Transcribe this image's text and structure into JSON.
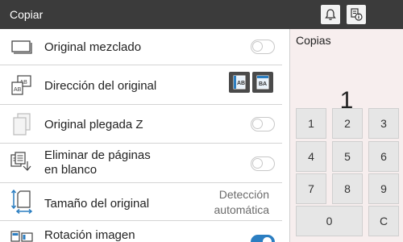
{
  "header": {
    "title": "Copiar"
  },
  "settings": [
    {
      "label": "Original mezclado",
      "control": "toggle",
      "on": false,
      "icon": "stacked-pages-icon"
    },
    {
      "label": "Dirección del original",
      "control": "direction-buttons",
      "icon": "page-orientation-icon",
      "options": [
        "AB",
        "BA"
      ]
    },
    {
      "label": "Original plegada Z",
      "control": "toggle",
      "on": false,
      "icon": "folded-page-icon"
    },
    {
      "label1": "Eliminar de páginas",
      "label2": "en blanco",
      "control": "toggle",
      "on": false,
      "icon": "remove-blank-pages-icon"
    },
    {
      "label": "Tamaño del original",
      "control": "value",
      "value1": "Detección",
      "value2": "automática",
      "icon": "original-size-icon"
    },
    {
      "label": "Rotación imagen",
      "control": "toggle",
      "on": true,
      "icon": "image-rotation-icon"
    }
  ],
  "copies": {
    "label": "Copias",
    "value": "1",
    "keys": [
      "1",
      "2",
      "3",
      "4",
      "5",
      "6",
      "7",
      "8",
      "9",
      "0",
      "C"
    ]
  },
  "colors": {
    "header": "#3b3b3b",
    "toggle_on": "#2b7ec1",
    "copies_bg": "#f7eeee"
  }
}
